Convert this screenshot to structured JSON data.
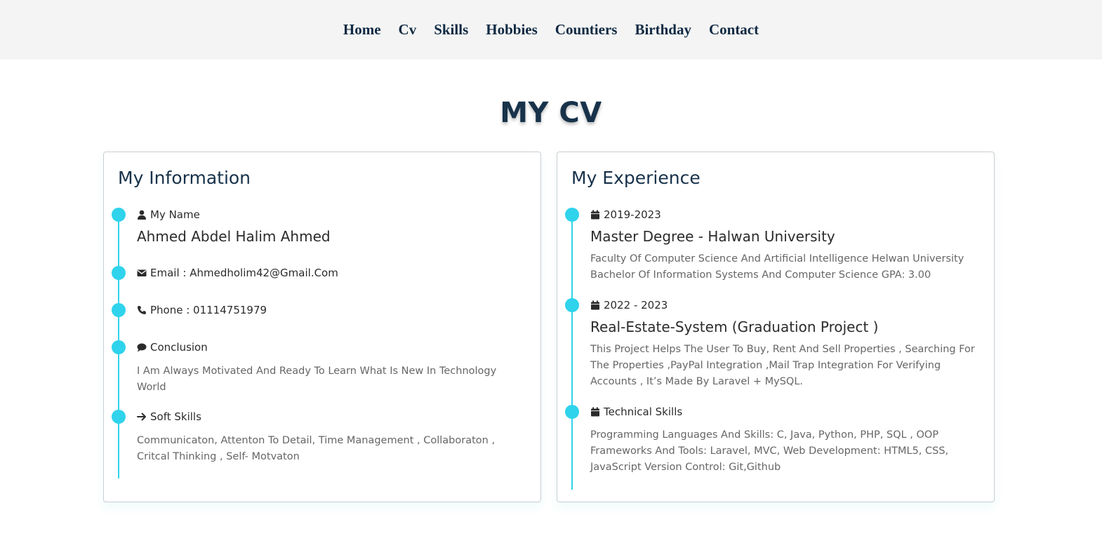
{
  "nav": {
    "items": [
      "Home",
      "Cv",
      "Skills",
      "Hobbies",
      "Countiers",
      "Birthday",
      "Contact"
    ]
  },
  "page_title": "MY CV",
  "colors": {
    "accent": "#2fd3ec",
    "heading": "#17324a",
    "navbar_bg": "#f4f4f4"
  },
  "info": {
    "title": "My Information",
    "name_label": "My Name",
    "name_value": "Ahmed Abdel Halim Ahmed",
    "email": "Email : Ahmedholim42@Gmail.Com",
    "phone": "Phone : 01114751979",
    "conclusion_label": "Conclusion",
    "conclusion_text": "I Am Always Motivated And Ready To Learn What Is New In Technology World",
    "soft_label": "Soft Skills",
    "soft_text": "Communicaton, Attenton To Detail, Time Management , Collaboraton , Critcal Thinking , Self- Motvaton"
  },
  "experience": {
    "title": "My Experience",
    "items": [
      {
        "date": "2019-2023",
        "heading": "Master Degree - Halwan University",
        "text": "Faculty Of Computer Science And Artificial Intelligence Helwan University Bachelor Of Information Systems And Computer Science GPA: 3.00"
      },
      {
        "date": "2022 - 2023",
        "heading": "Real-Estate-System (Graduation Project )",
        "text": "This Project Helps The User To Buy, Rent And Sell Properties , Searching For The Properties ,PayPal Integration ,Mail Trap Integration For Verifying Accounts , It’s Made By Laravel + MySQL."
      },
      {
        "date": "Technical Skills",
        "text": "Programming Languages And Skills: C, Java, Python, PHP, SQL , OOP Frameworks And Tools: Laravel, MVC, Web Development: HTML5, CSS, JavaScript Version Control: Git,Github"
      }
    ]
  },
  "icons": {
    "name": "user-icon",
    "email": "envelope-icon",
    "phone": "phone-icon",
    "conclusion": "comment-icon",
    "soft": "arrow-right-icon",
    "date": "calendar-icon"
  }
}
